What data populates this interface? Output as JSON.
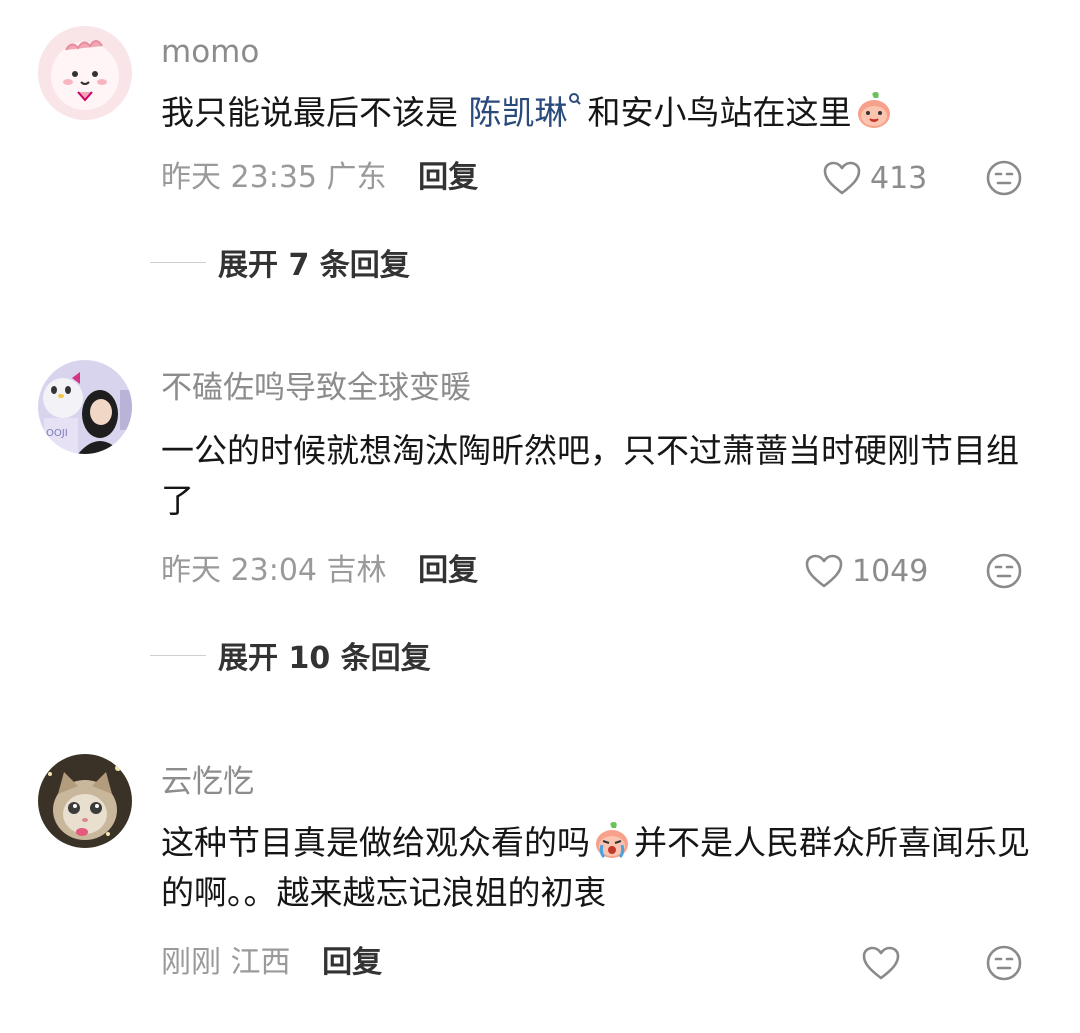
{
  "comments": [
    {
      "username": "momo",
      "text_before": "我只能说最后不该是 ",
      "mention": "陈凯琳",
      "text_after": "和安小鸟站在这里",
      "time": "昨天 23:35",
      "location": "广东",
      "reply_label": "回复",
      "likes": "413",
      "expand_label": "展开 7 条回复",
      "avatar_icon": "pink-cartoon-avatar",
      "emoji": "peach-smile-emoji"
    },
    {
      "username": "不磕佐鸣导致全球变暖",
      "text": "一公的时候就想淘汰陶昕然吧，只不过萧蔷当时硬刚节目组了",
      "time": "昨天 23:04",
      "location": "吉林",
      "reply_label": "回复",
      "likes": "1049",
      "expand_label": "展开 10 条回复",
      "avatar_icon": "girl-with-hello-kitty-avatar"
    },
    {
      "username": "云忔忔",
      "text_before": "这种节目真是做给观众看的吗",
      "text_after": "并不是人民群众所喜闻乐见的啊。。越来越忘记浪姐的初衷",
      "time": "刚刚",
      "location": "江西",
      "reply_label": "回复",
      "likes": "",
      "avatar_icon": "cat-avatar",
      "emoji": "peach-crying-emoji"
    }
  ],
  "icons": {
    "like": "heart-outline-icon",
    "dislike": "neutral-face-icon",
    "mention": "search-icon"
  },
  "colors": {
    "mention": "#2b4a7c",
    "meta": "#9a9a9a",
    "username": "#8c8c8c"
  }
}
